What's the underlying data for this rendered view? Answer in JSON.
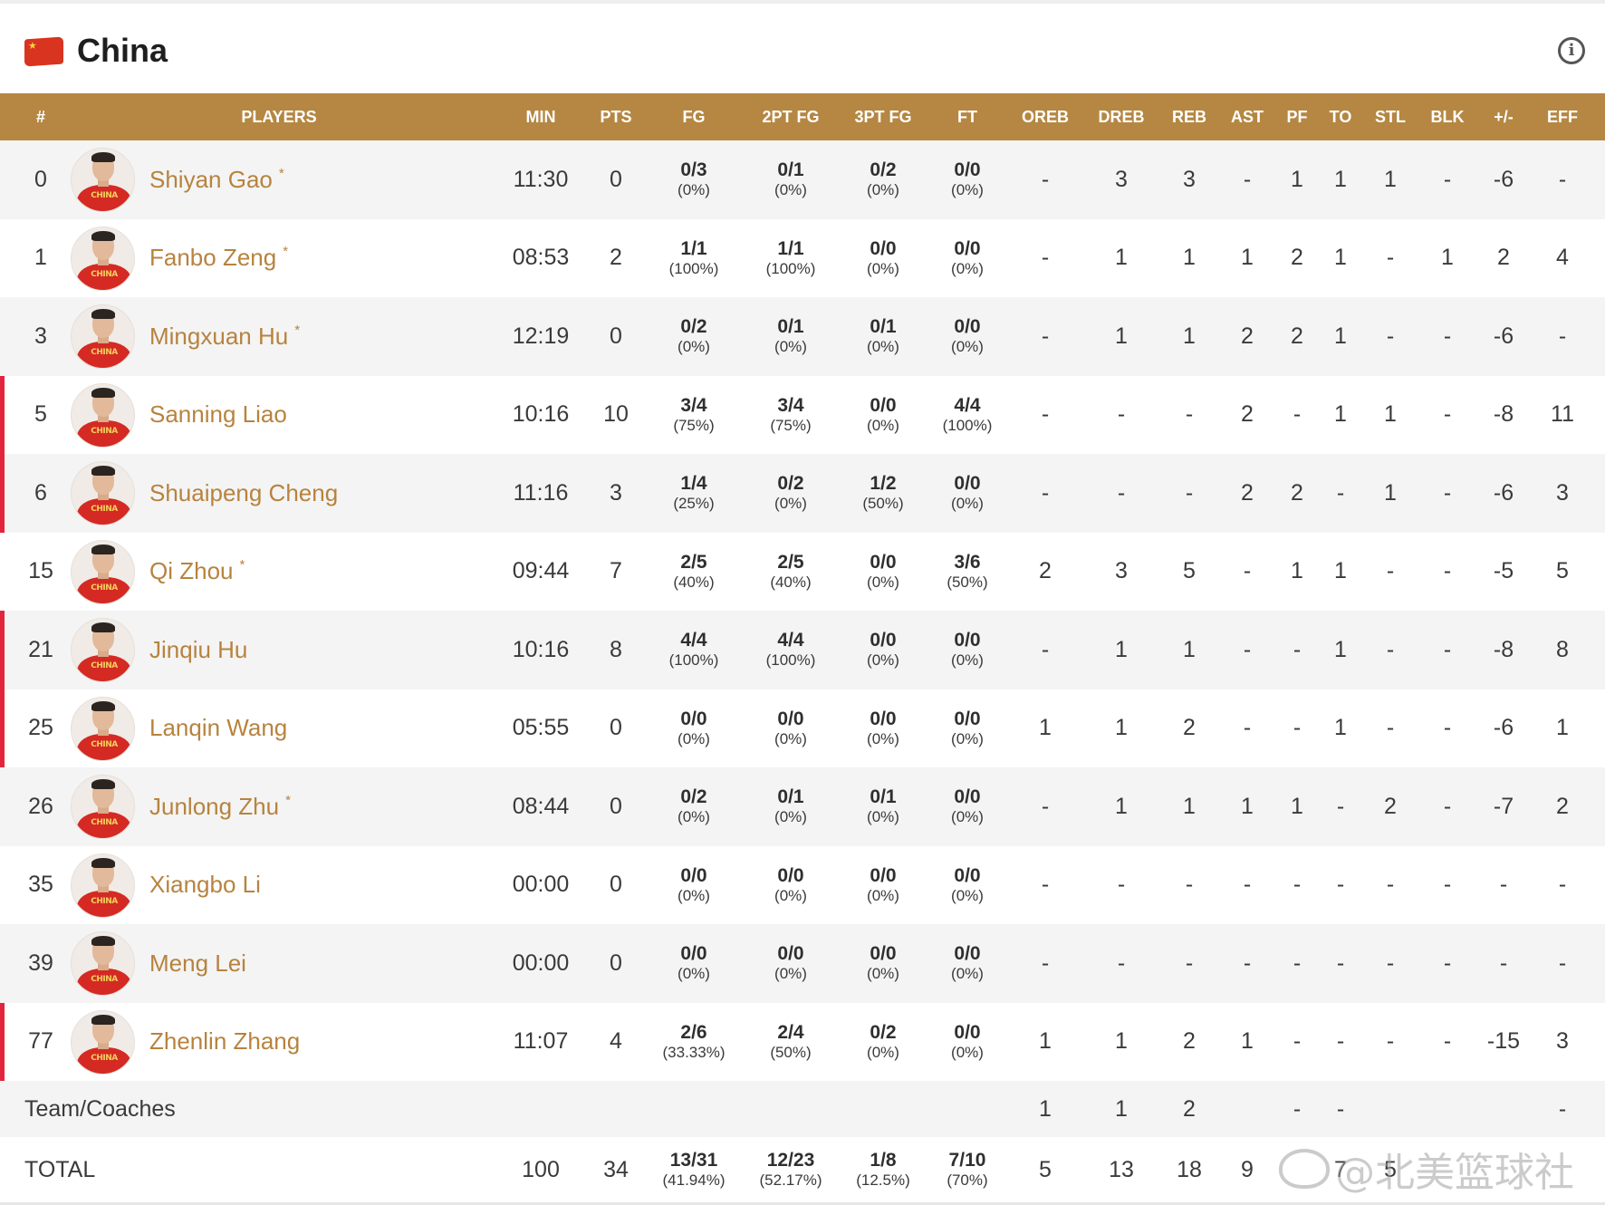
{
  "team": {
    "name": "China",
    "flag_icon": "china-flag-icon",
    "info_icon": "info-icon"
  },
  "colors": {
    "header_bg": "#b58742",
    "player_name": "#b7833e",
    "starter_bar": "#e2253c"
  },
  "columns": [
    "#",
    "PLAYERS",
    "MIN",
    "PTS",
    "FG",
    "2PT FG",
    "3PT FG",
    "FT",
    "OREB",
    "DREB",
    "REB",
    "AST",
    "PF",
    "TO",
    "STL",
    "BLK",
    "+/-",
    "EFF"
  ],
  "players": [
    {
      "no": "0",
      "name": "Shiyan Gao",
      "star": "*",
      "bar": false,
      "min": "11:30",
      "pts": "0",
      "fg": [
        "0/3",
        "(0%)"
      ],
      "fg2": [
        "0/1",
        "(0%)"
      ],
      "fg3": [
        "0/2",
        "(0%)"
      ],
      "ft": [
        "0/0",
        "(0%)"
      ],
      "oreb": "-",
      "dreb": "3",
      "reb": "3",
      "ast": "-",
      "pf": "1",
      "to": "1",
      "stl": "1",
      "blk": "-",
      "pm": "-6",
      "eff": "-"
    },
    {
      "no": "1",
      "name": "Fanbo Zeng",
      "star": "*",
      "bar": false,
      "min": "08:53",
      "pts": "2",
      "fg": [
        "1/1",
        "(100%)"
      ],
      "fg2": [
        "1/1",
        "(100%)"
      ],
      "fg3": [
        "0/0",
        "(0%)"
      ],
      "ft": [
        "0/0",
        "(0%)"
      ],
      "oreb": "-",
      "dreb": "1",
      "reb": "1",
      "ast": "1",
      "pf": "2",
      "to": "1",
      "stl": "-",
      "blk": "1",
      "pm": "2",
      "eff": "4"
    },
    {
      "no": "3",
      "name": "Mingxuan Hu",
      "star": "*",
      "bar": false,
      "min": "12:19",
      "pts": "0",
      "fg": [
        "0/2",
        "(0%)"
      ],
      "fg2": [
        "0/1",
        "(0%)"
      ],
      "fg3": [
        "0/1",
        "(0%)"
      ],
      "ft": [
        "0/0",
        "(0%)"
      ],
      "oreb": "-",
      "dreb": "1",
      "reb": "1",
      "ast": "2",
      "pf": "2",
      "to": "1",
      "stl": "-",
      "blk": "-",
      "pm": "-6",
      "eff": "-"
    },
    {
      "no": "5",
      "name": "Sanning Liao",
      "star": "",
      "bar": true,
      "min": "10:16",
      "pts": "10",
      "fg": [
        "3/4",
        "(75%)"
      ],
      "fg2": [
        "3/4",
        "(75%)"
      ],
      "fg3": [
        "0/0",
        "(0%)"
      ],
      "ft": [
        "4/4",
        "(100%)"
      ],
      "oreb": "-",
      "dreb": "-",
      "reb": "-",
      "ast": "2",
      "pf": "-",
      "to": "1",
      "stl": "1",
      "blk": "-",
      "pm": "-8",
      "eff": "11"
    },
    {
      "no": "6",
      "name": "Shuaipeng Cheng",
      "star": "",
      "bar": true,
      "min": "11:16",
      "pts": "3",
      "fg": [
        "1/4",
        "(25%)"
      ],
      "fg2": [
        "0/2",
        "(0%)"
      ],
      "fg3": [
        "1/2",
        "(50%)"
      ],
      "ft": [
        "0/0",
        "(0%)"
      ],
      "oreb": "-",
      "dreb": "-",
      "reb": "-",
      "ast": "2",
      "pf": "2",
      "to": "-",
      "stl": "1",
      "blk": "-",
      "pm": "-6",
      "eff": "3"
    },
    {
      "no": "15",
      "name": "Qi Zhou",
      "star": "*",
      "bar": false,
      "min": "09:44",
      "pts": "7",
      "fg": [
        "2/5",
        "(40%)"
      ],
      "fg2": [
        "2/5",
        "(40%)"
      ],
      "fg3": [
        "0/0",
        "(0%)"
      ],
      "ft": [
        "3/6",
        "(50%)"
      ],
      "oreb": "2",
      "dreb": "3",
      "reb": "5",
      "ast": "-",
      "pf": "1",
      "to": "1",
      "stl": "-",
      "blk": "-",
      "pm": "-5",
      "eff": "5"
    },
    {
      "no": "21",
      "name": "Jinqiu Hu",
      "star": "",
      "bar": true,
      "min": "10:16",
      "pts": "8",
      "fg": [
        "4/4",
        "(100%)"
      ],
      "fg2": [
        "4/4",
        "(100%)"
      ],
      "fg3": [
        "0/0",
        "(0%)"
      ],
      "ft": [
        "0/0",
        "(0%)"
      ],
      "oreb": "-",
      "dreb": "1",
      "reb": "1",
      "ast": "-",
      "pf": "-",
      "to": "1",
      "stl": "-",
      "blk": "-",
      "pm": "-8",
      "eff": "8"
    },
    {
      "no": "25",
      "name": "Lanqin Wang",
      "star": "",
      "bar": true,
      "min": "05:55",
      "pts": "0",
      "fg": [
        "0/0",
        "(0%)"
      ],
      "fg2": [
        "0/0",
        "(0%)"
      ],
      "fg3": [
        "0/0",
        "(0%)"
      ],
      "ft": [
        "0/0",
        "(0%)"
      ],
      "oreb": "1",
      "dreb": "1",
      "reb": "2",
      "ast": "-",
      "pf": "-",
      "to": "1",
      "stl": "-",
      "blk": "-",
      "pm": "-6",
      "eff": "1"
    },
    {
      "no": "26",
      "name": "Junlong Zhu",
      "star": "*",
      "bar": false,
      "min": "08:44",
      "pts": "0",
      "fg": [
        "0/2",
        "(0%)"
      ],
      "fg2": [
        "0/1",
        "(0%)"
      ],
      "fg3": [
        "0/1",
        "(0%)"
      ],
      "ft": [
        "0/0",
        "(0%)"
      ],
      "oreb": "-",
      "dreb": "1",
      "reb": "1",
      "ast": "1",
      "pf": "1",
      "to": "-",
      "stl": "2",
      "blk": "-",
      "pm": "-7",
      "eff": "2"
    },
    {
      "no": "35",
      "name": "Xiangbo Li",
      "star": "",
      "bar": false,
      "min": "00:00",
      "pts": "0",
      "fg": [
        "0/0",
        "(0%)"
      ],
      "fg2": [
        "0/0",
        "(0%)"
      ],
      "fg3": [
        "0/0",
        "(0%)"
      ],
      "ft": [
        "0/0",
        "(0%)"
      ],
      "oreb": "-",
      "dreb": "-",
      "reb": "-",
      "ast": "-",
      "pf": "-",
      "to": "-",
      "stl": "-",
      "blk": "-",
      "pm": "-",
      "eff": "-"
    },
    {
      "no": "39",
      "name": "Meng Lei",
      "star": "",
      "bar": false,
      "min": "00:00",
      "pts": "0",
      "fg": [
        "0/0",
        "(0%)"
      ],
      "fg2": [
        "0/0",
        "(0%)"
      ],
      "fg3": [
        "0/0",
        "(0%)"
      ],
      "ft": [
        "0/0",
        "(0%)"
      ],
      "oreb": "-",
      "dreb": "-",
      "reb": "-",
      "ast": "-",
      "pf": "-",
      "to": "-",
      "stl": "-",
      "blk": "-",
      "pm": "-",
      "eff": "-"
    },
    {
      "no": "77",
      "name": "Zhenlin Zhang",
      "star": "",
      "bar": true,
      "min": "11:07",
      "pts": "4",
      "fg": [
        "2/6",
        "(33.33%)"
      ],
      "fg2": [
        "2/4",
        "(50%)"
      ],
      "fg3": [
        "0/2",
        "(0%)"
      ],
      "ft": [
        "0/0",
        "(0%)"
      ],
      "oreb": "1",
      "dreb": "1",
      "reb": "2",
      "ast": "1",
      "pf": "-",
      "to": "-",
      "stl": "-",
      "blk": "-",
      "pm": "-15",
      "eff": "3"
    }
  ],
  "jersey_text": "CHINA",
  "team_row": {
    "label": "Team/Coaches",
    "oreb": "1",
    "dreb": "1",
    "reb": "2",
    "pf": "-",
    "to": "-",
    "eff": "-"
  },
  "total_row": {
    "label": "TOTAL",
    "min": "100",
    "pts": "34",
    "fg": [
      "13/31",
      "(41.94%)"
    ],
    "fg2": [
      "12/23",
      "(52.17%)"
    ],
    "fg3": [
      "1/8",
      "(12.5%)"
    ],
    "ft": [
      "7/10",
      "(70%)"
    ],
    "oreb": "5",
    "dreb": "13",
    "reb": "18",
    "ast": "9",
    "to": "7",
    "stl": "5"
  },
  "watermark": {
    "text": "@北美篮球社"
  }
}
